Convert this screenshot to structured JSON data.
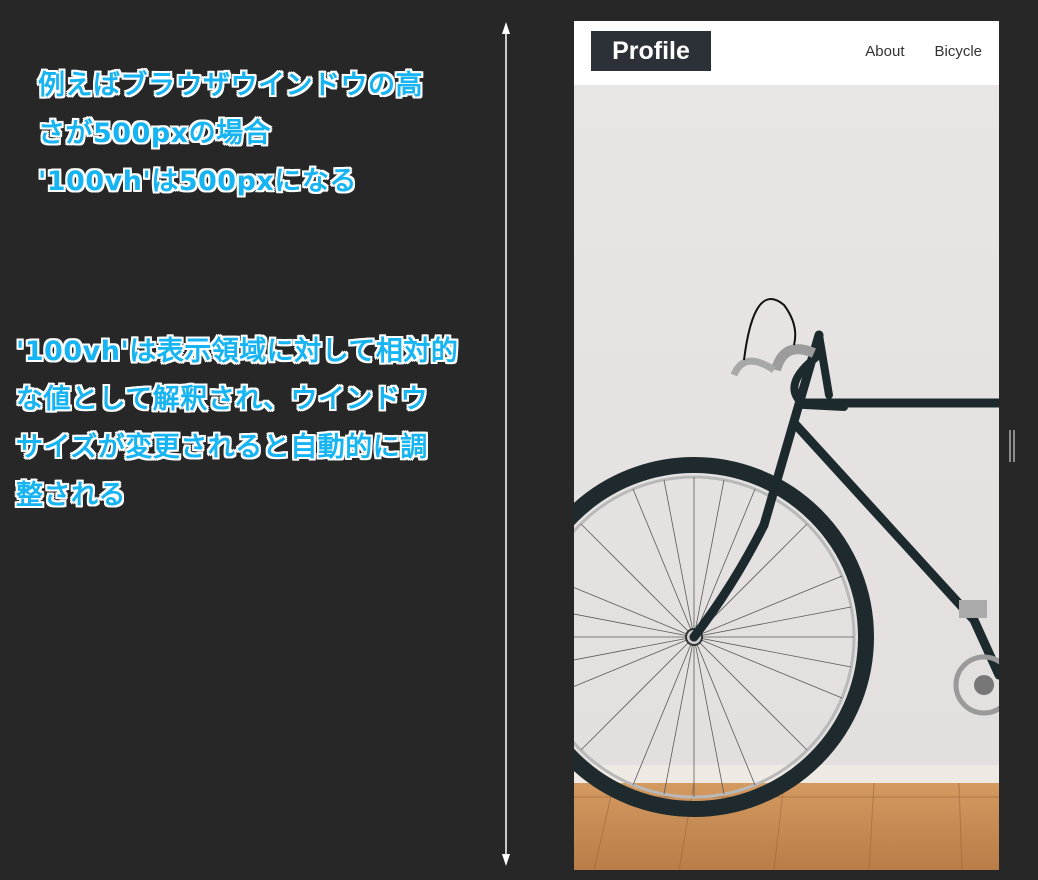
{
  "annotations": {
    "note1": {
      "line1": "例えばブラウザウインドウの高",
      "line2": "さが500pxの場合",
      "line3": "'100vh'は500pxになる"
    },
    "note2": {
      "line1": "'100vh'は表示領域に対して相対的",
      "line2": "な値として解釈され、ウインドウ",
      "line3": "サイズが変更されると自動的に調",
      "line4": "整される"
    }
  },
  "site": {
    "logo": "Profile",
    "nav": [
      "About",
      "Bicycle"
    ]
  },
  "colors": {
    "background": "#272727",
    "annotation_text": "#16b4f2",
    "annotation_outline": "#ffffff",
    "logo_bg": "#2c3138",
    "wall": "#e4e1e0",
    "floor": "#c98d55"
  },
  "icons": {
    "height_arrow": "double-arrow-vertical-icon",
    "scroll_handle": "resize-handle-icon"
  }
}
